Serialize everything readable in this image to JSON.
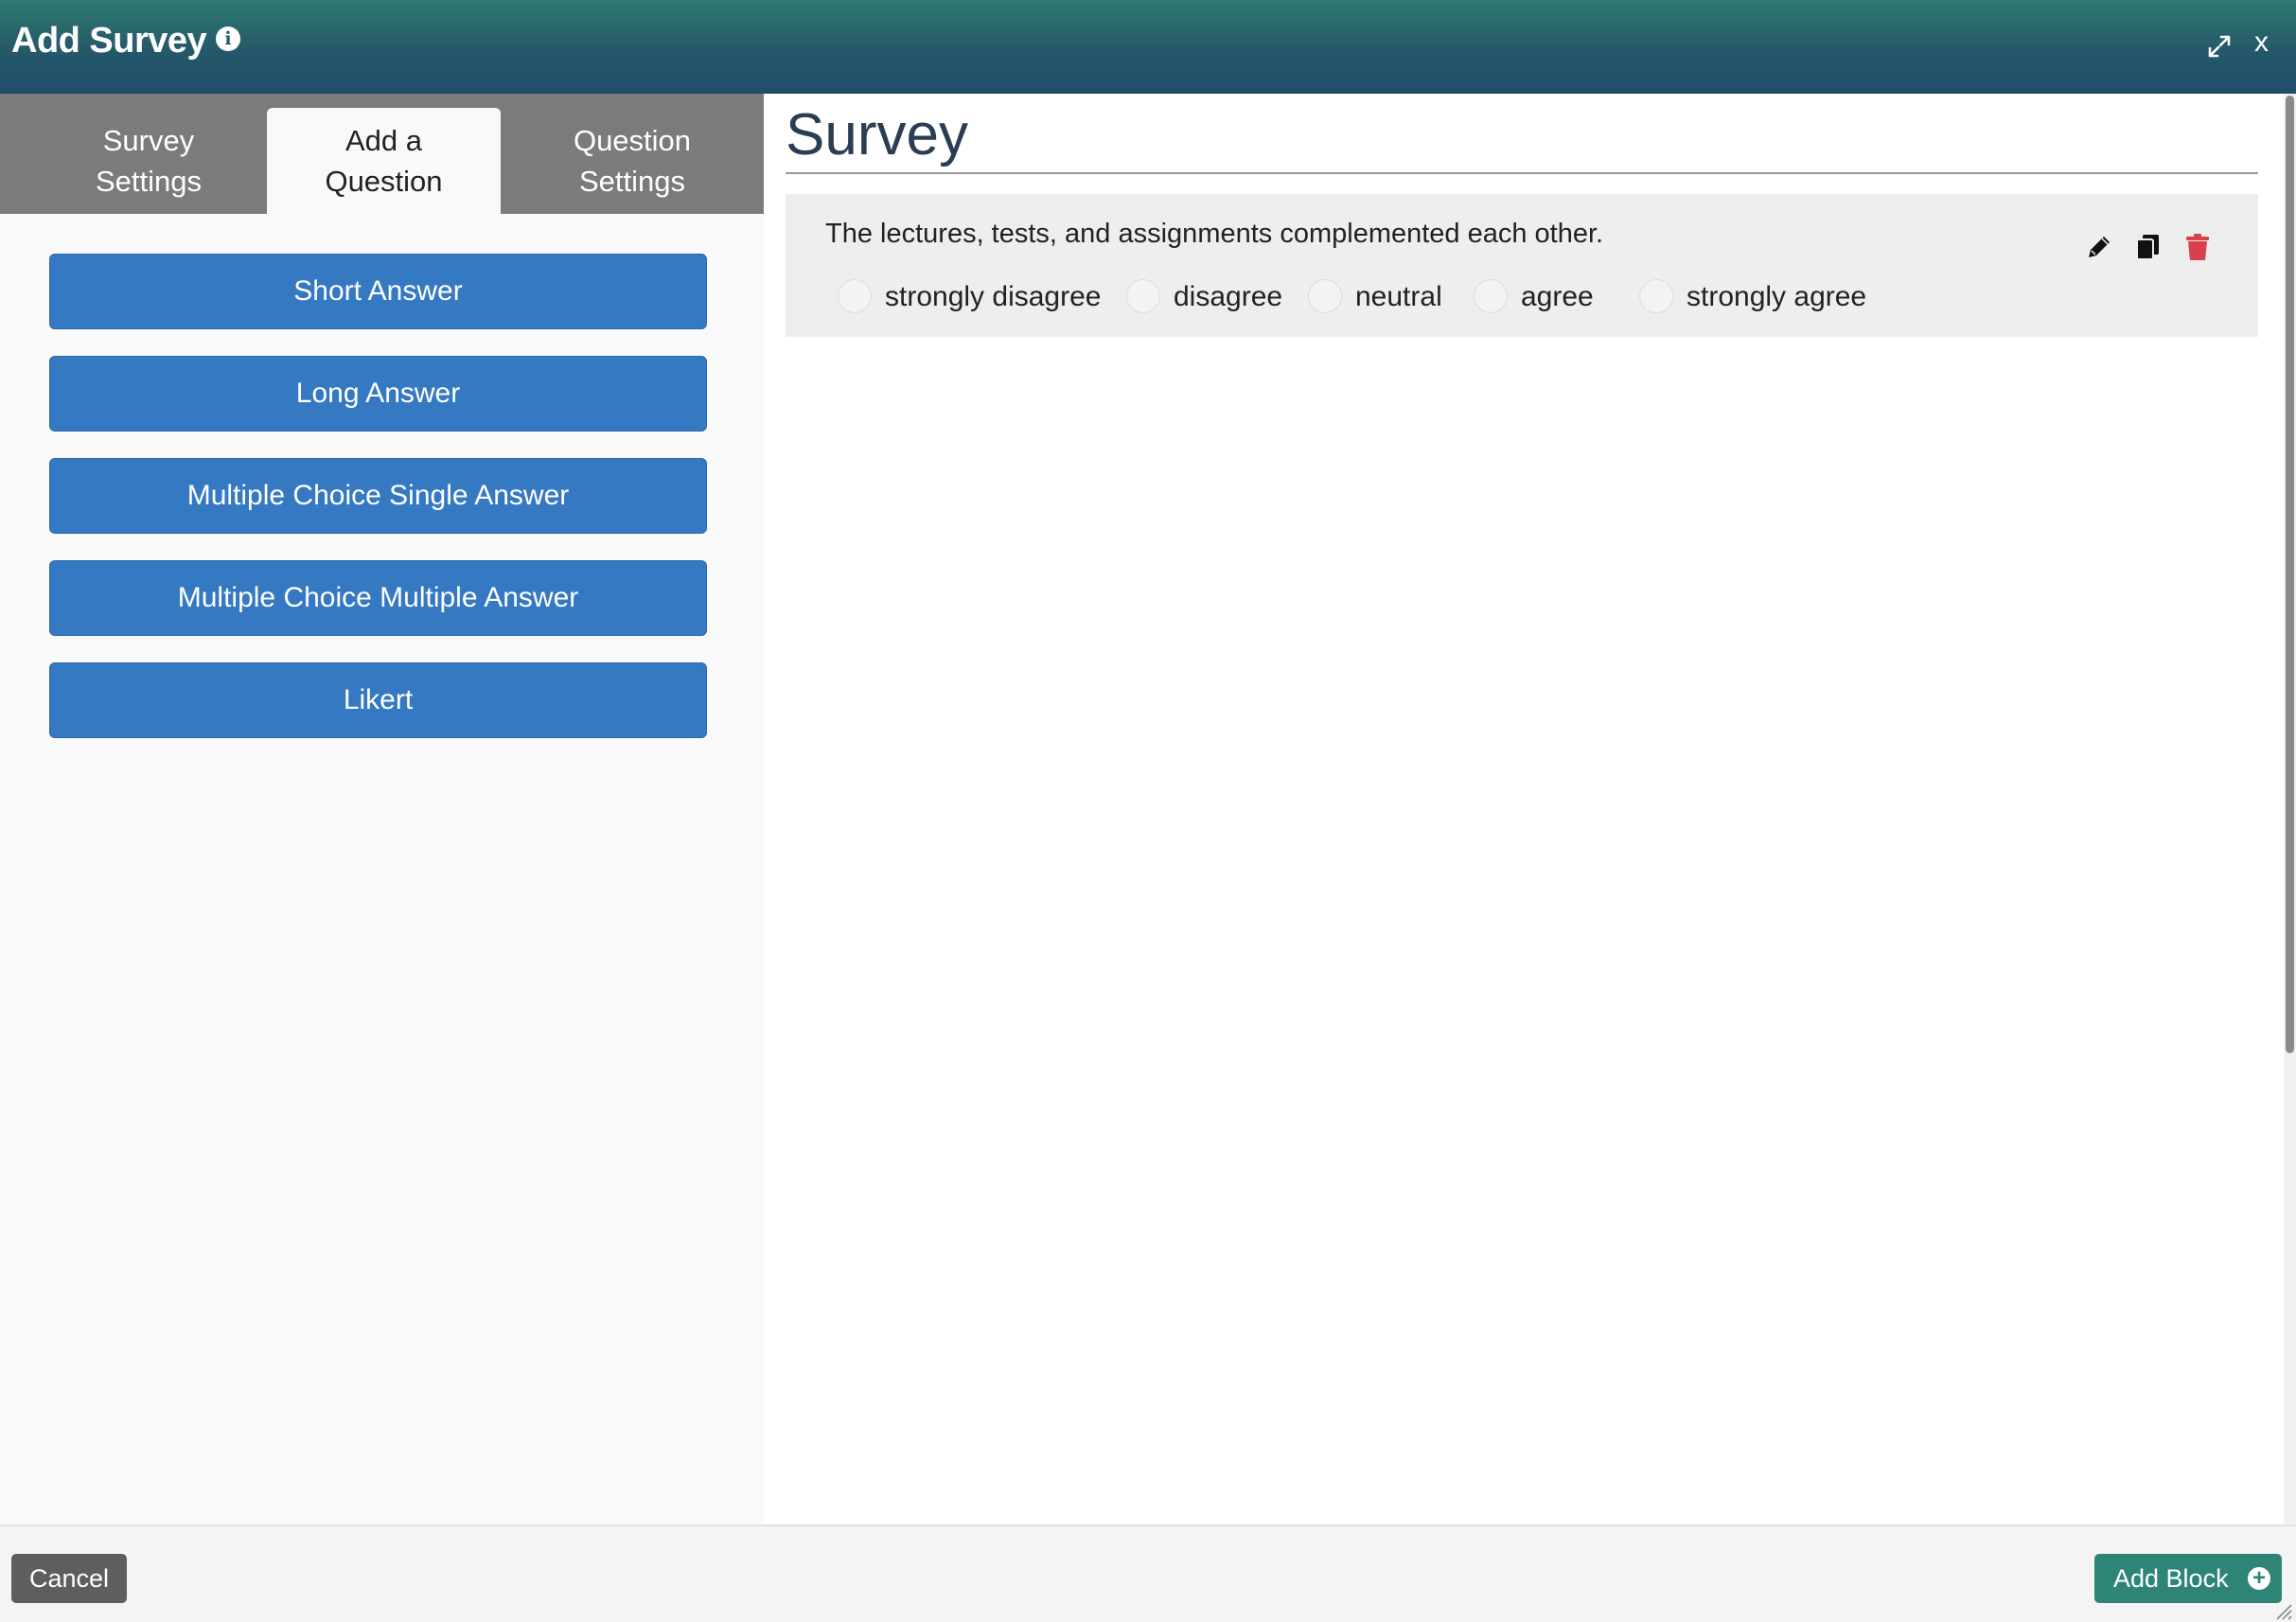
{
  "window": {
    "title": "Add Survey",
    "icons": {
      "info": "info-icon",
      "expand": "expand-icon",
      "close": "x"
    }
  },
  "tabs": [
    {
      "line1": "Survey",
      "line2": "Settings",
      "active": false
    },
    {
      "line1": "Add a",
      "line2": "Question",
      "active": true
    },
    {
      "line1": "Question",
      "line2": "Settings",
      "active": false
    }
  ],
  "question_types": [
    "Short Answer",
    "Long Answer",
    "Multiple Choice Single Answer",
    "Multiple Choice Multiple Answer",
    "Likert"
  ],
  "survey": {
    "heading": "Survey",
    "questions": [
      {
        "text": "The lectures, tests, and assignments complemented each other.",
        "options": [
          "strongly disagree",
          "disagree",
          "neutral",
          "agree",
          "strongly agree"
        ],
        "actions": {
          "edit": "pencil-icon",
          "copy": "copy-icon",
          "delete": "trash-icon"
        }
      }
    ]
  },
  "footer": {
    "cancel_label": "Cancel",
    "add_block_label": "Add Block",
    "add_block_icon": "plus-circle-icon"
  },
  "colors": {
    "header_gradient_start": "#2f7a6e",
    "header_gradient_end": "#214c6b",
    "question_button": "#3479c2",
    "tab_strip": "#7a7b7a",
    "delete_icon": "#d9404a",
    "add_block_button": "#2e8577",
    "cancel_button": "#5e5e5e"
  }
}
